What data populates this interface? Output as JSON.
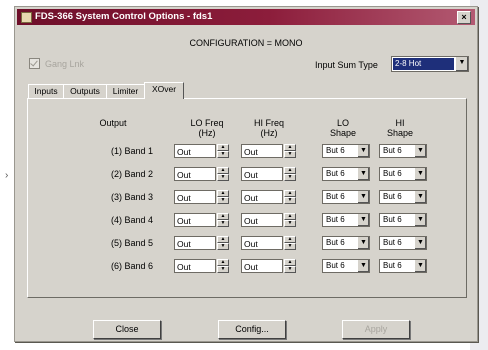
{
  "window": {
    "title": "FDS-366 System Control Options - fds1",
    "close_icon": "close-icon"
  },
  "configuration": {
    "label": "CONFIGURATION = MONO"
  },
  "ganged": {
    "label": "Gang Lnk",
    "checked": true,
    "enabled": false
  },
  "input_sum_type": {
    "label": "Input Sum Type",
    "value": "2-8 Hot"
  },
  "tabs": [
    {
      "label": "Inputs",
      "active": false
    },
    {
      "label": "Outputs",
      "active": false
    },
    {
      "label": "Limiter",
      "active": false
    },
    {
      "label": "XOver",
      "active": true
    }
  ],
  "xover": {
    "headers": {
      "output": "Output",
      "lo_freq": "LO Freq\n(Hz)",
      "hi_freq": "HI Freq\n(Hz)",
      "lo_shape": "LO\nShape",
      "hi_shape": "HI\nShape"
    },
    "rows": [
      {
        "label": "(1) Band 1",
        "lo_freq": "Out",
        "hi_freq": "Out",
        "lo_shape": "But 6",
        "hi_shape": "But 6"
      },
      {
        "label": "(2) Band 2",
        "lo_freq": "Out",
        "hi_freq": "Out",
        "lo_shape": "But 6",
        "hi_shape": "But 6"
      },
      {
        "label": "(3) Band 3",
        "lo_freq": "Out",
        "hi_freq": "Out",
        "lo_shape": "But 6",
        "hi_shape": "But 6"
      },
      {
        "label": "(4) Band 4",
        "lo_freq": "Out",
        "hi_freq": "Out",
        "lo_shape": "But 6",
        "hi_shape": "But 6"
      },
      {
        "label": "(5) Band 5",
        "lo_freq": "Out",
        "hi_freq": "Out",
        "lo_shape": "But 6",
        "hi_shape": "But 6"
      },
      {
        "label": "(6) Band 6",
        "lo_freq": "Out",
        "hi_freq": "Out",
        "lo_shape": "But 6",
        "hi_shape": "But 6"
      }
    ]
  },
  "buttons": {
    "close": "Close",
    "config": "Config...",
    "apply": "Apply"
  },
  "colors": {
    "titlebar": "#8c1d3b",
    "selection": "#1e2f7a",
    "face": "#d6d3cc"
  }
}
